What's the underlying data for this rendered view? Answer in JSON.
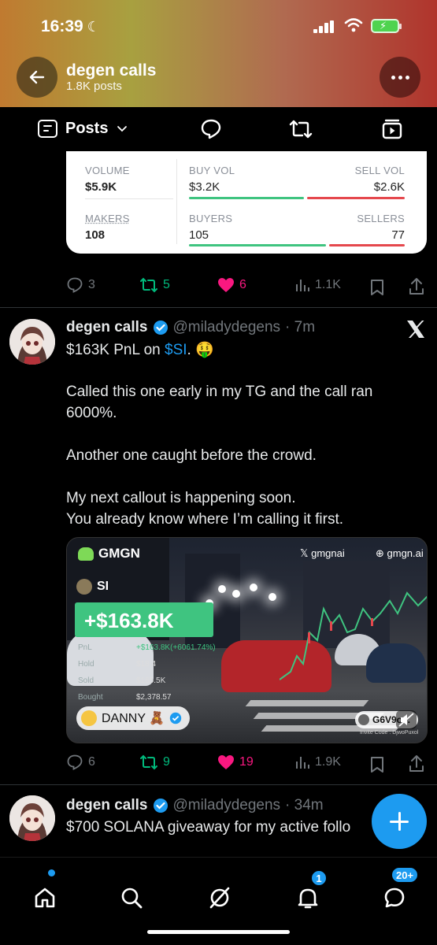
{
  "status_bar": {
    "time": "16:39",
    "battery": "⚡"
  },
  "header": {
    "title": "degen calls",
    "subtitle": "1.8K posts"
  },
  "tabs": {
    "posts_label": "Posts"
  },
  "card": {
    "volume_label": "VOLUME",
    "volume_value": "$5.9K",
    "buy_vol_label": "BUY VOL",
    "buy_vol_value": "$3.2K",
    "sell_vol_label": "SELL VOL",
    "sell_vol_value": "$2.6K",
    "makers_label": "MAKERS",
    "makers_value": "108",
    "buyers_label": "BUYERS",
    "buyers_value": "105",
    "sellers_label": "SELLERS",
    "sellers_value": "77",
    "colors": {
      "buy": "#3fc480",
      "sell": "#e5484d"
    }
  },
  "post1_actions": {
    "replies": "3",
    "reposts": "5",
    "likes": "6",
    "views": "1.1K"
  },
  "post2": {
    "name": "degen calls",
    "handle": "@miladydegens",
    "time": "· 7m",
    "line1_a": "$163K PnL on ",
    "line1_tag": "$SI",
    "line1_b": ". 🤑",
    "line2": "Called this one early in my TG and the call ran",
    "line3": "6000%.",
    "line4": "Another one caught before the crowd.",
    "line5": "My next callout is happening soon.",
    "line6": "You already know where I’m calling it first.",
    "media": {
      "brand": "GMGN",
      "x_handle": "gmgnai",
      "site": "gmgn.ai",
      "symbol": "SI",
      "pnl": "+$163.8K",
      "rows": [
        {
          "label": "PnL",
          "value": "+$163.8K(+6061.74%)"
        },
        {
          "label": "Hold",
          "value": "$18.4"
        },
        {
          "label": "Sold",
          "value": "$165.5K"
        },
        {
          "label": "Bought",
          "value": "$2,378.57"
        }
      ],
      "user": "DANNY 🧸",
      "code_chip": "G6V9o...",
      "invite": "Invite Code : DjwoPuxol"
    },
    "actions": {
      "replies": "6",
      "reposts": "9",
      "likes": "19",
      "views": "1.9K"
    }
  },
  "post3": {
    "name": "degen calls",
    "handle": "@miladydegens",
    "time": "· 34m",
    "line1": "$700 SOLANA giveaway for my active follo"
  },
  "bottom_nav": {
    "notifications_badge": "1",
    "messages_badge": "20+"
  },
  "colors": {
    "accent": "#1d9bf0",
    "repost": "#00ba7c",
    "like": "#f91880",
    "muted": "#71767b"
  }
}
